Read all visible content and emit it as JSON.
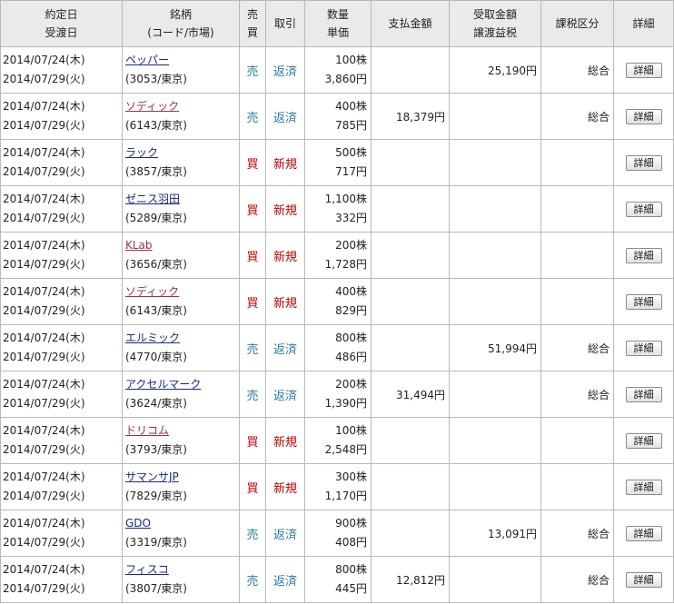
{
  "header": {
    "date1": "約定日",
    "date2": "受渡日",
    "stock1": "銘柄",
    "stock2": "(コード/市場)",
    "side1": "売",
    "side2": "買",
    "trade": "取引",
    "qty1": "数量",
    "qty2": "単価",
    "payment": "支払金額",
    "receive1": "受取金額",
    "receive2": "譲渡益税",
    "tax": "課税区分",
    "detail": "詳細"
  },
  "colors": {
    "sell": "#2a7aa0",
    "buy": "#bb0000",
    "link": "#1a2a7a",
    "visited_link": "#993344",
    "header_bg": "#eaeaea",
    "border": "#b9b9b9"
  },
  "detail_icon": "button",
  "rows": [
    {
      "exec_date": "2014/07/24(木)",
      "settle_date": "2014/07/29(火)",
      "name": "ペッパー",
      "code": "(3053/東京)",
      "side": "売",
      "side_type": "sell",
      "trade": "返済",
      "qty": "100株",
      "price": "3,860円",
      "payment": "",
      "receive": "25,190円",
      "tax": "総合",
      "detail": "詳細",
      "visited": false
    },
    {
      "exec_date": "2014/07/24(木)",
      "settle_date": "2014/07/29(火)",
      "name": "ソディック",
      "code": "(6143/東京)",
      "side": "売",
      "side_type": "sell",
      "trade": "返済",
      "qty": "400株",
      "price": "785円",
      "payment": "18,379円",
      "receive": "",
      "tax": "総合",
      "detail": "詳細",
      "visited": true
    },
    {
      "exec_date": "2014/07/24(木)",
      "settle_date": "2014/07/29(火)",
      "name": "ラック",
      "code": "(3857/東京)",
      "side": "買",
      "side_type": "buy",
      "trade": "新規",
      "qty": "500株",
      "price": "717円",
      "payment": "",
      "receive": "",
      "tax": "",
      "detail": "詳細",
      "visited": false
    },
    {
      "exec_date": "2014/07/24(木)",
      "settle_date": "2014/07/29(火)",
      "name": "ゼニス羽田",
      "code": "(5289/東京)",
      "side": "買",
      "side_type": "buy",
      "trade": "新規",
      "qty": "1,100株",
      "price": "332円",
      "payment": "",
      "receive": "",
      "tax": "",
      "detail": "詳細",
      "visited": false
    },
    {
      "exec_date": "2014/07/24(木)",
      "settle_date": "2014/07/29(火)",
      "name": "KLab",
      "code": "(3656/東京)",
      "side": "買",
      "side_type": "buy",
      "trade": "新規",
      "qty": "200株",
      "price": "1,728円",
      "payment": "",
      "receive": "",
      "tax": "",
      "detail": "詳細",
      "visited": true
    },
    {
      "exec_date": "2014/07/24(木)",
      "settle_date": "2014/07/29(火)",
      "name": "ソディック",
      "code": "(6143/東京)",
      "side": "買",
      "side_type": "buy",
      "trade": "新規",
      "qty": "400株",
      "price": "829円",
      "payment": "",
      "receive": "",
      "tax": "",
      "detail": "詳細",
      "visited": true
    },
    {
      "exec_date": "2014/07/24(木)",
      "settle_date": "2014/07/29(火)",
      "name": "エルミック",
      "code": "(4770/東京)",
      "side": "売",
      "side_type": "sell",
      "trade": "返済",
      "qty": "800株",
      "price": "486円",
      "payment": "",
      "receive": "51,994円",
      "tax": "総合",
      "detail": "詳細",
      "visited": false
    },
    {
      "exec_date": "2014/07/24(木)",
      "settle_date": "2014/07/29(火)",
      "name": "アクセルマーク",
      "code": "(3624/東京)",
      "side": "売",
      "side_type": "sell",
      "trade": "返済",
      "qty": "200株",
      "price": "1,390円",
      "payment": "31,494円",
      "receive": "",
      "tax": "総合",
      "detail": "詳細",
      "visited": false
    },
    {
      "exec_date": "2014/07/24(木)",
      "settle_date": "2014/07/29(火)",
      "name": "ドリコム",
      "code": "(3793/東京)",
      "side": "買",
      "side_type": "buy",
      "trade": "新規",
      "qty": "100株",
      "price": "2,548円",
      "payment": "",
      "receive": "",
      "tax": "",
      "detail": "詳細",
      "visited": true
    },
    {
      "exec_date": "2014/07/24(木)",
      "settle_date": "2014/07/29(火)",
      "name": "サマンサJP",
      "code": "(7829/東京)",
      "side": "買",
      "side_type": "buy",
      "trade": "新規",
      "qty": "300株",
      "price": "1,170円",
      "payment": "",
      "receive": "",
      "tax": "",
      "detail": "詳細",
      "visited": false
    },
    {
      "exec_date": "2014/07/24(木)",
      "settle_date": "2014/07/29(火)",
      "name": "GDO",
      "code": "(3319/東京)",
      "side": "売",
      "side_type": "sell",
      "trade": "返済",
      "qty": "900株",
      "price": "408円",
      "payment": "",
      "receive": "13,091円",
      "tax": "総合",
      "detail": "詳細",
      "visited": false
    },
    {
      "exec_date": "2014/07/24(木)",
      "settle_date": "2014/07/29(火)",
      "name": "フィスコ",
      "code": "(3807/東京)",
      "side": "売",
      "side_type": "sell",
      "trade": "返済",
      "qty": "800株",
      "price": "445円",
      "payment": "12,812円",
      "receive": "",
      "tax": "総合",
      "detail": "詳細",
      "visited": false
    }
  ]
}
